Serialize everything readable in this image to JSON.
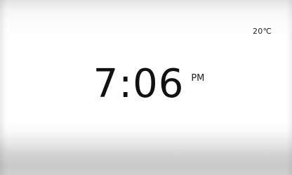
{
  "status": {
    "temperature": "20℃"
  },
  "clock": {
    "time": "7:06",
    "period": "PM"
  }
}
